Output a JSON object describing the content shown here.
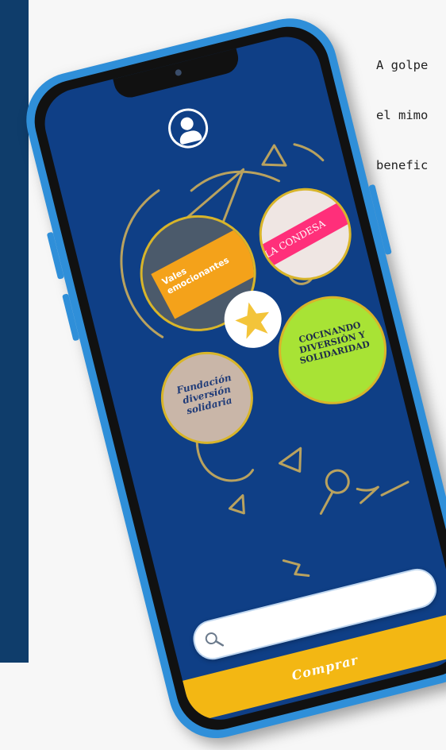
{
  "side_text": {
    "line1": "A golpe",
    "line2": "el mimo",
    "line3": "benefic"
  },
  "phone": {
    "photos": {
      "vales": "Vales emocionantes",
      "condesa": "LA CONDESA",
      "fundacion": "Fundación diversión solidaria",
      "cocinando": "COCINANDO DIVERSIÓN Y SOLIDARIDAD"
    },
    "search": {
      "value": "",
      "placeholder": ""
    },
    "buy_label": "Comprar"
  },
  "colors": {
    "screen_bg": "#0f3f86",
    "accent": "#f3b713",
    "frame": "#2f8fd9",
    "doodle": "#b9a25f"
  },
  "icons": [
    "profile-icon",
    "star-logo-icon",
    "search-icon"
  ]
}
